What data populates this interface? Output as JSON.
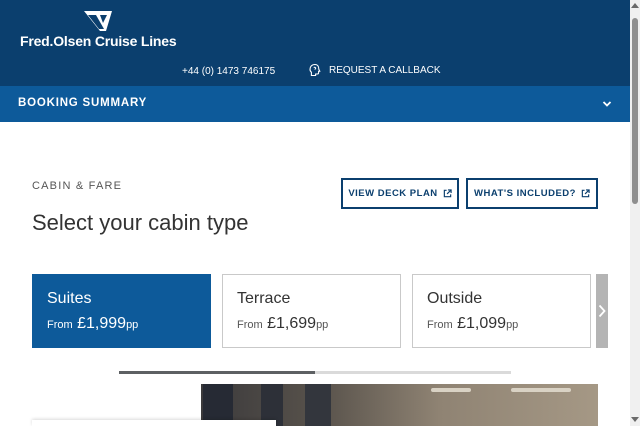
{
  "header": {
    "logo_text": "Fred.Olsen Cruise Lines",
    "phone": "+44 (0) 1473 746175",
    "callback_label": "REQUEST A CALLBACK",
    "logo_icon": "fred-olsen-flag-logo",
    "callback_icon": "head-callback-icon"
  },
  "booking_summary": {
    "title": "BOOKING SUMMARY",
    "toggle_icon": "chevron-down-icon"
  },
  "section": {
    "label": "CABIN & FARE",
    "title": "Select your cabin type"
  },
  "actions": {
    "deck_plan_label": "VIEW DECK PLAN",
    "whats_included_label": "WHAT'S INCLUDED?",
    "external_icon": "external-link-icon"
  },
  "cabins": [
    {
      "name": "Suites",
      "from": "From",
      "price": "£1,999",
      "unit": "pp",
      "selected": true
    },
    {
      "name": "Terrace",
      "from": "From",
      "price": "£1,699",
      "unit": "pp",
      "selected": false
    },
    {
      "name": "Outside",
      "from": "From",
      "price": "£1,099",
      "unit": "pp",
      "selected": false
    }
  ],
  "carousel": {
    "progress": 0.5,
    "next_icon": "chevron-right-icon"
  },
  "colors": {
    "header_bg": "#0b3f6e",
    "accent": "#0d5a9a",
    "text": "#333333"
  }
}
